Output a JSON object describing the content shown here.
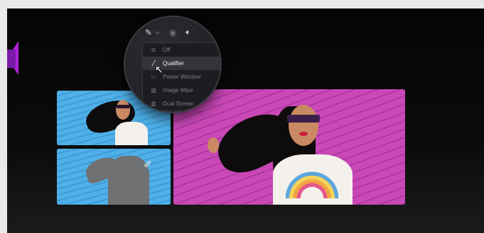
{
  "toolbar": {
    "pen_icon": "pen-icon",
    "chevron_icon": "chevron-down-icon",
    "eye_icon": "eye-icon",
    "audio_icon": "speaker-icon"
  },
  "menu": {
    "items": [
      {
        "label": "Off",
        "icon": "disabled-icon",
        "active": false
      },
      {
        "label": "Qualifier",
        "icon": "qualifier-icon",
        "active": true
      },
      {
        "label": "Power Window",
        "icon": "window-icon",
        "active": false
      },
      {
        "label": "Image Wipe",
        "icon": "wipe-icon",
        "active": false
      },
      {
        "label": "Dual Screen",
        "icon": "dual-screen-icon",
        "active": false
      }
    ]
  },
  "colors": {
    "accent_purple": "#b020d8",
    "blue_wall": "#4fb0e8",
    "pink_wall": "#c948b6"
  }
}
